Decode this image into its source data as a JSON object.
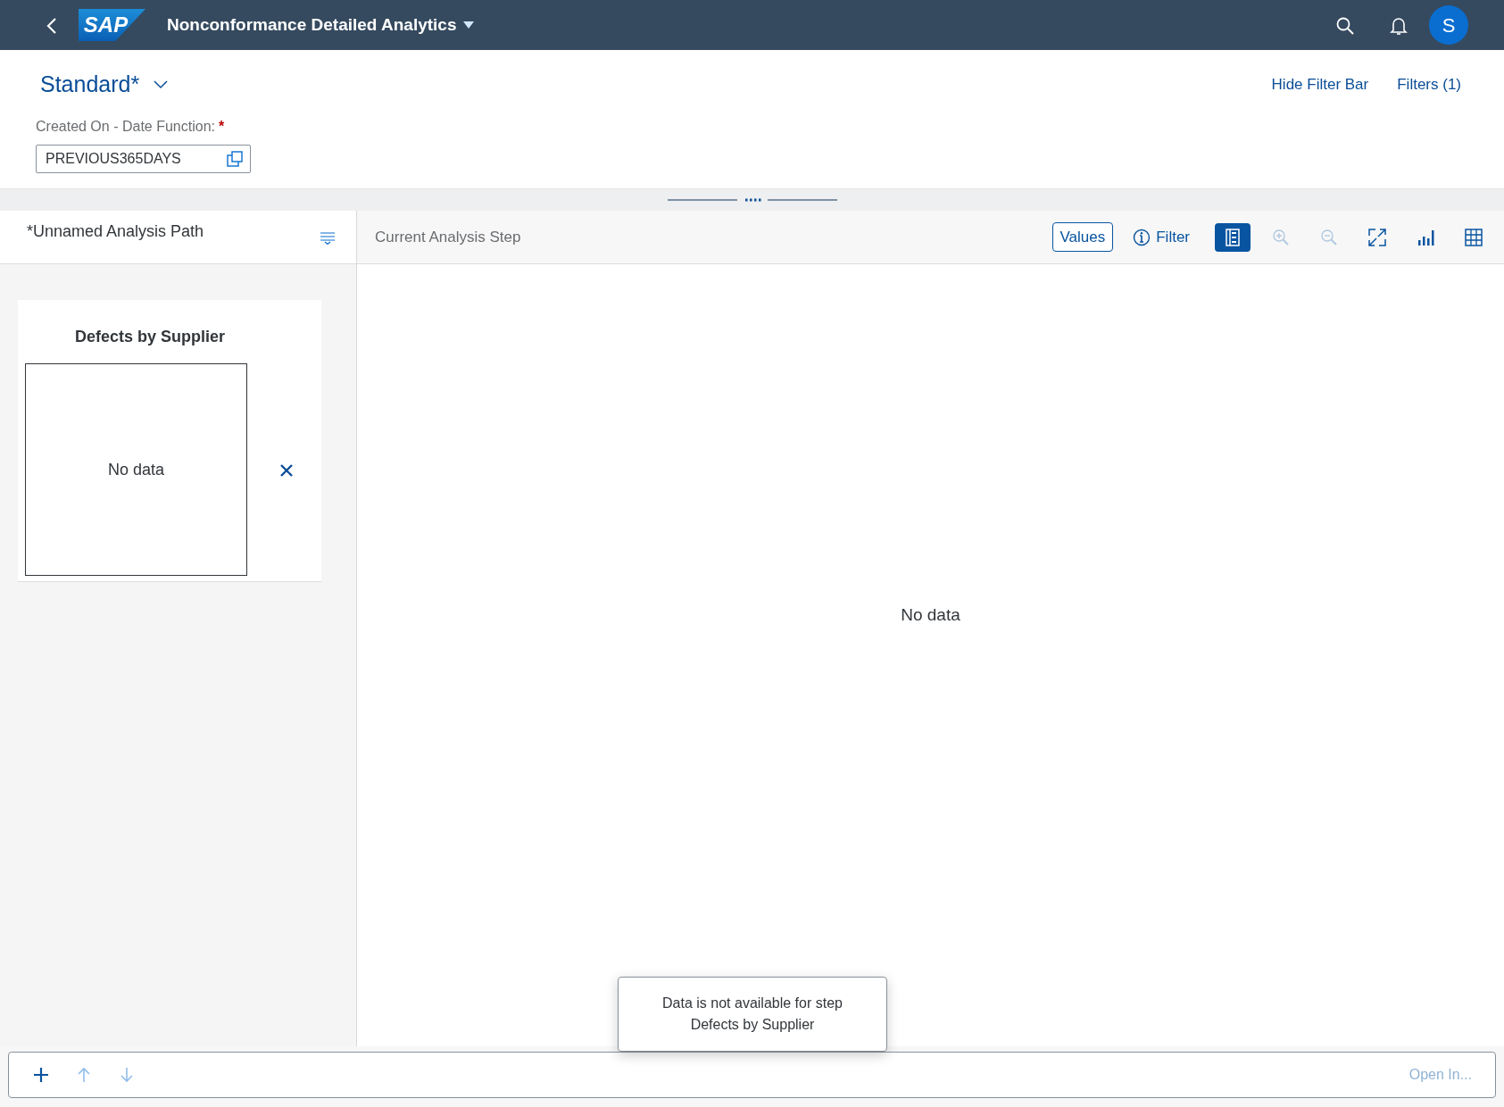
{
  "shell_bar": {
    "logo": "SAP",
    "title": "Nonconformance Detailed Analytics",
    "avatar": "S"
  },
  "filter_bar": {
    "variant": "Standard*",
    "links": [
      "Hide Filter Bar",
      "Filters (1)"
    ],
    "fields": [
      {
        "label": "Created On - Date Function:",
        "required_mark": "*",
        "value": "PREVIOUS365DAYS"
      }
    ]
  },
  "analysis_path": {
    "title": "*Unnamed Analysis Path",
    "steps": [
      {
        "title": "Defects by Supplier",
        "message": "No data"
      }
    ]
  },
  "current_step": {
    "title": "Current Analysis Step",
    "values_button": "Values",
    "filter_button": "Filter",
    "tools": [
      {
        "selected": true,
        "disabled": false
      },
      {
        "selected": false,
        "disabled": true
      },
      {
        "selected": false,
        "disabled": true
      },
      {
        "selected": false,
        "disabled": false
      },
      {
        "selected": false,
        "disabled": false
      },
      {
        "selected": false,
        "disabled": false
      }
    ],
    "message": "No data"
  },
  "toast": {
    "lines": [
      "Data is not available for step",
      "Defects by Supplier"
    ]
  },
  "footer": {
    "buttons": [
      {
        "disabled": false
      },
      {
        "disabled": true
      },
      {
        "disabled": true
      }
    ],
    "open_in": {
      "label": "Open In...",
      "disabled": true
    }
  }
}
